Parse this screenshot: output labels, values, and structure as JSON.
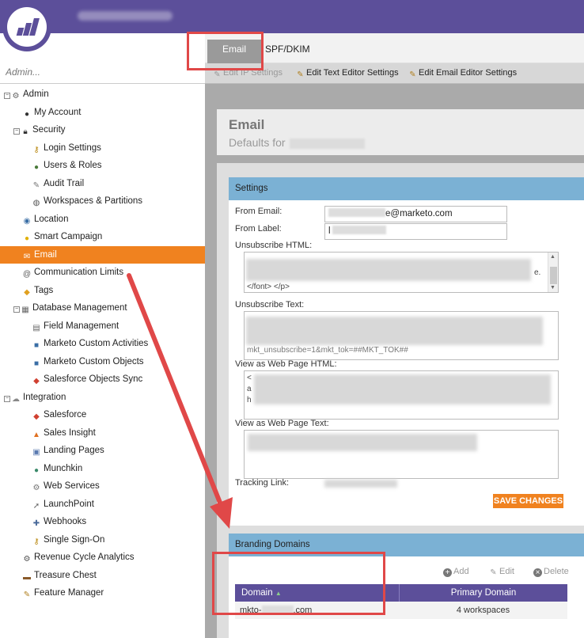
{
  "sidebar": {
    "search_placeholder": "Admin...",
    "items": [
      {
        "label": "Admin"
      },
      {
        "label": "My Account"
      },
      {
        "label": "Security"
      },
      {
        "label": "Login Settings"
      },
      {
        "label": "Users & Roles"
      },
      {
        "label": "Audit Trail"
      },
      {
        "label": "Workspaces & Partitions"
      },
      {
        "label": "Location"
      },
      {
        "label": "Smart Campaign"
      },
      {
        "label": "Email"
      },
      {
        "label": "Communication Limits"
      },
      {
        "label": "Tags"
      },
      {
        "label": "Database Management"
      },
      {
        "label": "Field Management"
      },
      {
        "label": "Marketo Custom Activities"
      },
      {
        "label": "Marketo Custom Objects"
      },
      {
        "label": "Salesforce Objects Sync"
      },
      {
        "label": "Integration"
      },
      {
        "label": "Salesforce"
      },
      {
        "label": "Sales Insight"
      },
      {
        "label": "Landing Pages"
      },
      {
        "label": "Munchkin"
      },
      {
        "label": "Web Services"
      },
      {
        "label": "LaunchPoint"
      },
      {
        "label": "Webhooks"
      },
      {
        "label": "Single Sign-On"
      },
      {
        "label": "Revenue Cycle Analytics"
      },
      {
        "label": "Treasure Chest"
      },
      {
        "label": "Feature Manager"
      }
    ]
  },
  "tabs": {
    "email": "Email",
    "spf": "SPF/DKIM"
  },
  "toolbar": {
    "edit_ip": "Edit IP Settings",
    "edit_text": "Edit Text Editor Settings",
    "edit_email": "Edit Email Editor Settings"
  },
  "header": {
    "title": "Email",
    "subtitle": "Defaults for"
  },
  "settings": {
    "title": "Settings",
    "from_email_label": "From Email:",
    "from_email_value": "e@marketo.com",
    "from_label_label": "From Label:",
    "from_label_value": "l",
    "unsub_html_label": "Unsubscribe HTML:",
    "unsub_html_snippet": "</font> </p>",
    "unsub_html_tail": "e.",
    "unsub_text_label": "Unsubscribe Text:",
    "unsub_text_snippet": "mkt_unsubscribe=1&mkt_tok=##MKT_TOK##",
    "webpage_html_label": "View as Web Page HTML:",
    "webpage_html_snippet_1": "<",
    "webpage_html_snippet_2": "a",
    "webpage_html_snippet_3": "h",
    "webpage_text_label": "View as Web Page Text:",
    "tracking_label": "Tracking Link:",
    "save_button": "SAVE CHANGES"
  },
  "branding": {
    "title": "Branding Domains",
    "add": "Add",
    "edit": "Edit",
    "delete": "Delete",
    "columns": {
      "domain": "Domain",
      "primary": "Primary Domain"
    },
    "rows": [
      {
        "domain_prefix": "mkto-",
        "domain_suffix": ".com",
        "primary": "4 workspaces"
      }
    ]
  },
  "colors": {
    "brand": "#5c4f9a",
    "accent": "#f0821f",
    "panel_header": "#7bb1d4",
    "annotation": "#e04848"
  }
}
